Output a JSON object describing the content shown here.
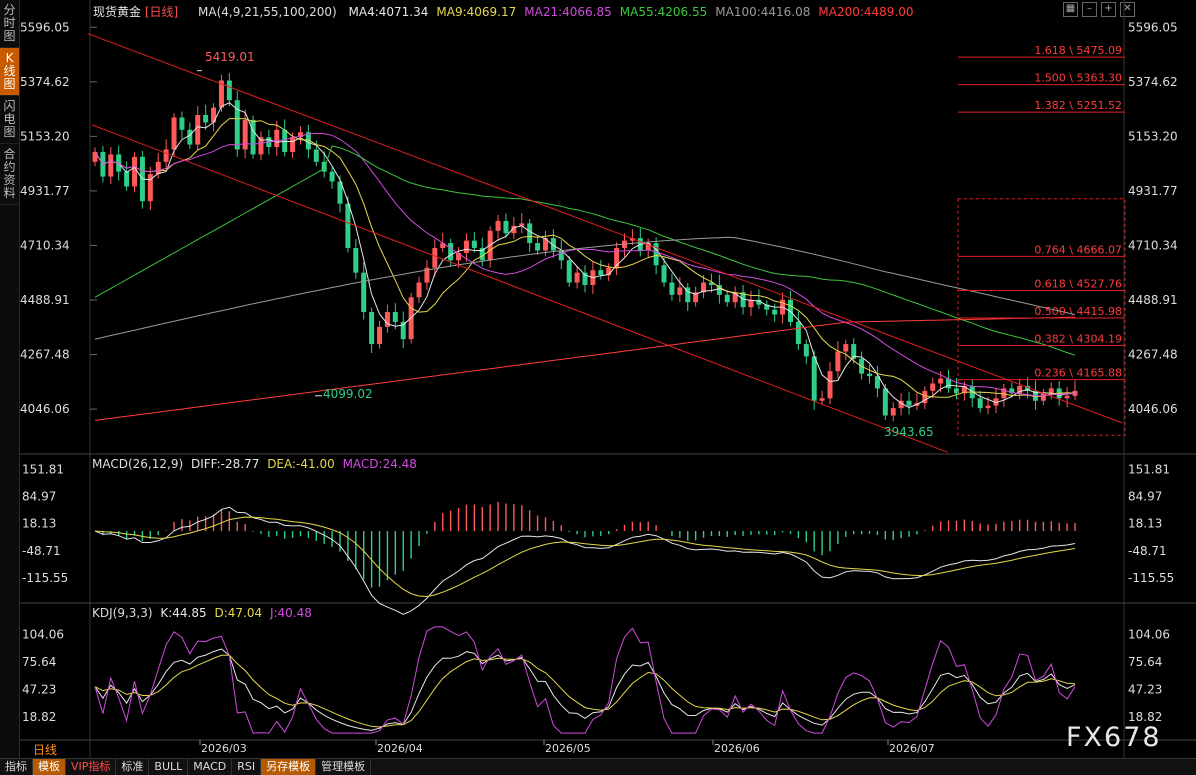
{
  "sidebar": {
    "tabs": [
      {
        "label": "分时图",
        "active": false
      },
      {
        "label": "K线图",
        "active": true
      },
      {
        "label": "闪电图",
        "active": false
      },
      {
        "label": "合约资料",
        "active": false
      }
    ]
  },
  "header": {
    "instrument": "现货黄金",
    "period": "[日线]",
    "ma_params": "MA(4,9,21,55,100,200)",
    "ma": [
      {
        "label": "MA4:4071.34",
        "color": "#e6e6e6"
      },
      {
        "label": "MA9:4069.17",
        "color": "#e6d84a"
      },
      {
        "label": "MA21:4066.85",
        "color": "#d24be0"
      },
      {
        "label": "MA55:4206.55",
        "color": "#3cc83c"
      },
      {
        "label": "MA100:4416.08",
        "color": "#9a9a9a"
      },
      {
        "label": "MA200:4489.00",
        "color": "#ff3c3c"
      }
    ]
  },
  "macd_header": {
    "label": "MACD(26,12,9)",
    "diff": "DIFF:-28.77",
    "dea": "DEA:-41.00",
    "macd": "MACD:24.48"
  },
  "kdj_header": {
    "label": "KDJ(9,3,3)",
    "k": "K:44.85",
    "d": "D:47.04",
    "j": "J:40.48"
  },
  "price_axis_ticks": [
    "5596.05",
    "5374.62",
    "5153.20",
    "4931.77",
    "4710.34",
    "4488.91",
    "4267.48",
    "4046.06"
  ],
  "macd_axis_ticks": [
    "151.81",
    "84.97",
    "18.13",
    "-48.71",
    "-115.55"
  ],
  "kdj_axis_ticks": [
    "104.06",
    "75.64",
    "47.23",
    "18.82"
  ],
  "time_labels": [
    "2026/03",
    "2026/04",
    "2026/05",
    "2026/06",
    "2026/07"
  ],
  "annotations": {
    "high": "5419.01",
    "low1": "4099.02",
    "low2": "3943.65"
  },
  "fib_upper": [
    {
      "text": "1.618 \\ 5475.09",
      "value": 5475.09
    },
    {
      "text": "1.500 \\ 5363.30",
      "value": 5363.3
    },
    {
      "text": "1.382 \\ 5251.52",
      "value": 5251.52
    }
  ],
  "fib_lower": [
    {
      "text": "0.764 \\ 4666.07",
      "value": 4666.07
    },
    {
      "text": "0.618 \\ 4527.76",
      "value": 4527.76
    },
    {
      "text": "0.500 \\ 4415.98",
      "value": 4415.98
    },
    {
      "text": "0.382 \\ 4304.19",
      "value": 4304.19
    },
    {
      "text": "0.236 \\ 4165.88",
      "value": 4165.88
    }
  ],
  "toolbar": {
    "period": "日线",
    "tabs": [
      {
        "label": "指标",
        "style": ""
      },
      {
        "label": "模板",
        "style": "hi"
      },
      {
        "label": "VIP指标",
        "style": "red"
      },
      {
        "label": "标准",
        "style": ""
      },
      {
        "label": "BULL",
        "style": ""
      },
      {
        "label": "MACD",
        "style": ""
      },
      {
        "label": "RSI",
        "style": ""
      },
      {
        "label": "另存模板",
        "style": "hi"
      },
      {
        "label": "管理模板",
        "style": ""
      }
    ]
  },
  "watermark": "FX678",
  "colors": {
    "up": "#ff5a5a",
    "down": "#2fcf8a",
    "trend": "#e02020",
    "ma4": "#e6e6e6",
    "ma9": "#e6d84a",
    "ma21": "#d24be0",
    "ma55": "#3cc83c",
    "ma100": "#9a9a9a",
    "ma200": "#ff3c3c"
  },
  "chart_data": {
    "type": "candlestick",
    "price_range": [
      3880,
      5650
    ],
    "candles_close": [
      5090,
      4990,
      5080,
      5010,
      4950,
      5070,
      4890,
      5000,
      5050,
      5100,
      5230,
      5180,
      5120,
      5240,
      5210,
      5270,
      5380,
      5300,
      5100,
      5220,
      5080,
      5150,
      5110,
      5180,
      5090,
      5150,
      5170,
      5100,
      5050,
      5010,
      4970,
      4880,
      4700,
      4600,
      4440,
      4310,
      4380,
      4440,
      4400,
      4330,
      4500,
      4560,
      4620,
      4700,
      4720,
      4650,
      4680,
      4730,
      4700,
      4650,
      4770,
      4810,
      4760,
      4790,
      4800,
      4720,
      4690,
      4740,
      4690,
      4650,
      4560,
      4600,
      4550,
      4610,
      4590,
      4620,
      4700,
      4730,
      4740,
      4690,
      4720,
      4630,
      4560,
      4510,
      4540,
      4480,
      4520,
      4560,
      4550,
      4510,
      4480,
      4520,
      4460,
      4490,
      4470,
      4450,
      4430,
      4490,
      4400,
      4310,
      4260,
      4080,
      4090,
      4200,
      4280,
      4310,
      4250,
      4190,
      4180,
      4130,
      4020,
      4050,
      4080,
      4060,
      4070,
      4120,
      4150,
      4170,
      4130,
      4110,
      4140,
      4090,
      4050,
      4060,
      4090,
      4130,
      4110,
      4140,
      4120,
      4080,
      4110,
      4130,
      4090,
      4100,
      4120
    ],
    "macd_range": [
      -160,
      160
    ],
    "kdj_range": [
      0,
      115
    ]
  }
}
